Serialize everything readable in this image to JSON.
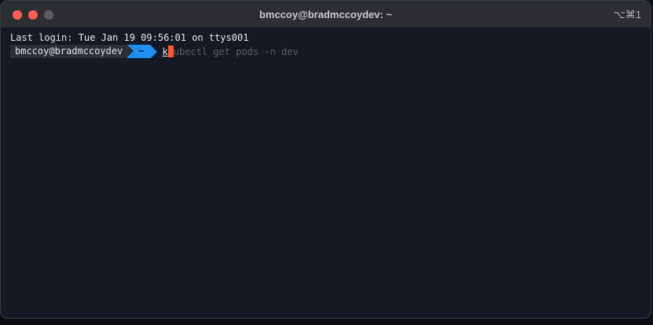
{
  "window": {
    "title": "bmccoy@bradmccoydev: ~",
    "shortcut": "⌥⌘1"
  },
  "terminal": {
    "last_login": "Last login: Tue Jan 19 09:56:01 on ttys001",
    "prompt_user": "bmccoy@bradmccoydev",
    "prompt_dir": "~",
    "typed_text": "k",
    "autosuggestion": "ubectl get pods -n dev"
  },
  "colors": {
    "close": "#fe5f57",
    "prompt_dir_bg": "#1f8ff0",
    "cursor": "#ff5b2e"
  }
}
